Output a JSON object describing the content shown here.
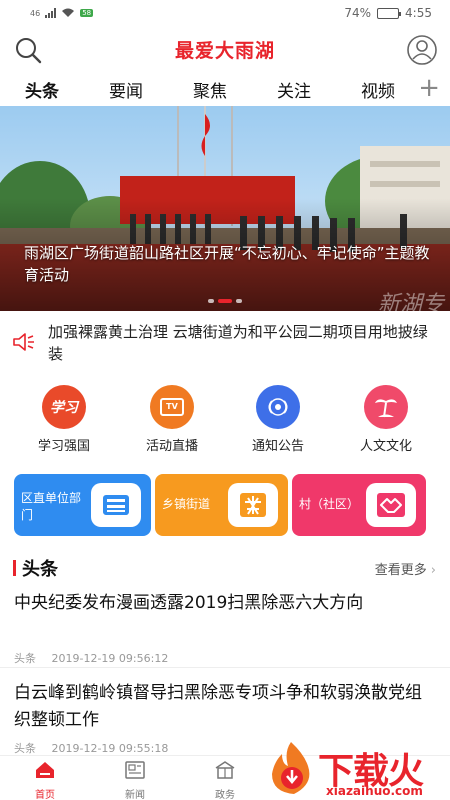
{
  "status_bar": {
    "signal_text": "46",
    "wifi_badge": "58",
    "battery": "74%",
    "battery_level": 0.74,
    "time": "4:55"
  },
  "header": {
    "title": "最爱大雨湖",
    "search_icon": "search-icon",
    "user_icon": "user-icon"
  },
  "tabs": [
    {
      "label": "头条",
      "active": true
    },
    {
      "label": "要闻"
    },
    {
      "label": "聚焦"
    },
    {
      "label": "关注"
    },
    {
      "label": "视频"
    }
  ],
  "tab_add_icon": "plus-icon",
  "banner": {
    "caption": "雨湖区广场街道韶山路社区开展“不忘初心、牢记使命”主题教育活动",
    "slide_count": 3,
    "active_slide": 2,
    "watermark": "新湖专"
  },
  "notice": {
    "icon": "speaker-icon",
    "text": "加强裸露黄土治理 云塘街道为和平公园二期项目用地披绿装"
  },
  "quick_links": [
    {
      "label": "学习强国",
      "icon": "study-icon",
      "icon_text": "学习",
      "color": "#e94a2a"
    },
    {
      "label": "活动直播",
      "icon": "tv-icon",
      "icon_text": "TV",
      "color": "#f07a22"
    },
    {
      "label": "通知公告",
      "icon": "broadcast-icon",
      "icon_text": "",
      "color": "#3e6fe8"
    },
    {
      "label": "人文文化",
      "icon": "palm-tree-icon",
      "icon_text": "",
      "color": "#f04a6a"
    }
  ],
  "category_cards": [
    {
      "label": "区直单位部门",
      "icon": "building-icon",
      "color": "#2f8cf0"
    },
    {
      "label": "乡镇街道",
      "icon": "street-icon",
      "color": "#f79a1f"
    },
    {
      "label": "村（社区）",
      "icon": "handshake-icon",
      "color": "#f0386a"
    }
  ],
  "section": {
    "title": "头条",
    "more": "查看更多",
    "more_icon": "chevron-right-icon"
  },
  "news": [
    {
      "title": "中央纪委发布漫画透露2019扫黑除恶六大方向",
      "source": "头条",
      "time": "2019-12-19 09:56:12"
    },
    {
      "title": "白云峰到鹤岭镇督导扫黑除恶专项斗争和软弱涣散党组织整顿工作",
      "source": "头条",
      "time": "2019-12-19 09:55:18"
    }
  ],
  "bottom_nav": [
    {
      "label": "首页",
      "icon": "home-icon",
      "active": true
    },
    {
      "label": "新闻",
      "icon": "news-icon"
    },
    {
      "label": "政务",
      "icon": "government-icon"
    }
  ],
  "brand_watermark": {
    "text": "下载火",
    "domain": "xiazaihuo.com",
    "icon": "flame-logo-icon"
  },
  "colors": {
    "accent": "#e8242c",
    "card_blue": "#2f8cf0",
    "card_orange": "#f79a1f",
    "card_pink": "#f0386a"
  }
}
